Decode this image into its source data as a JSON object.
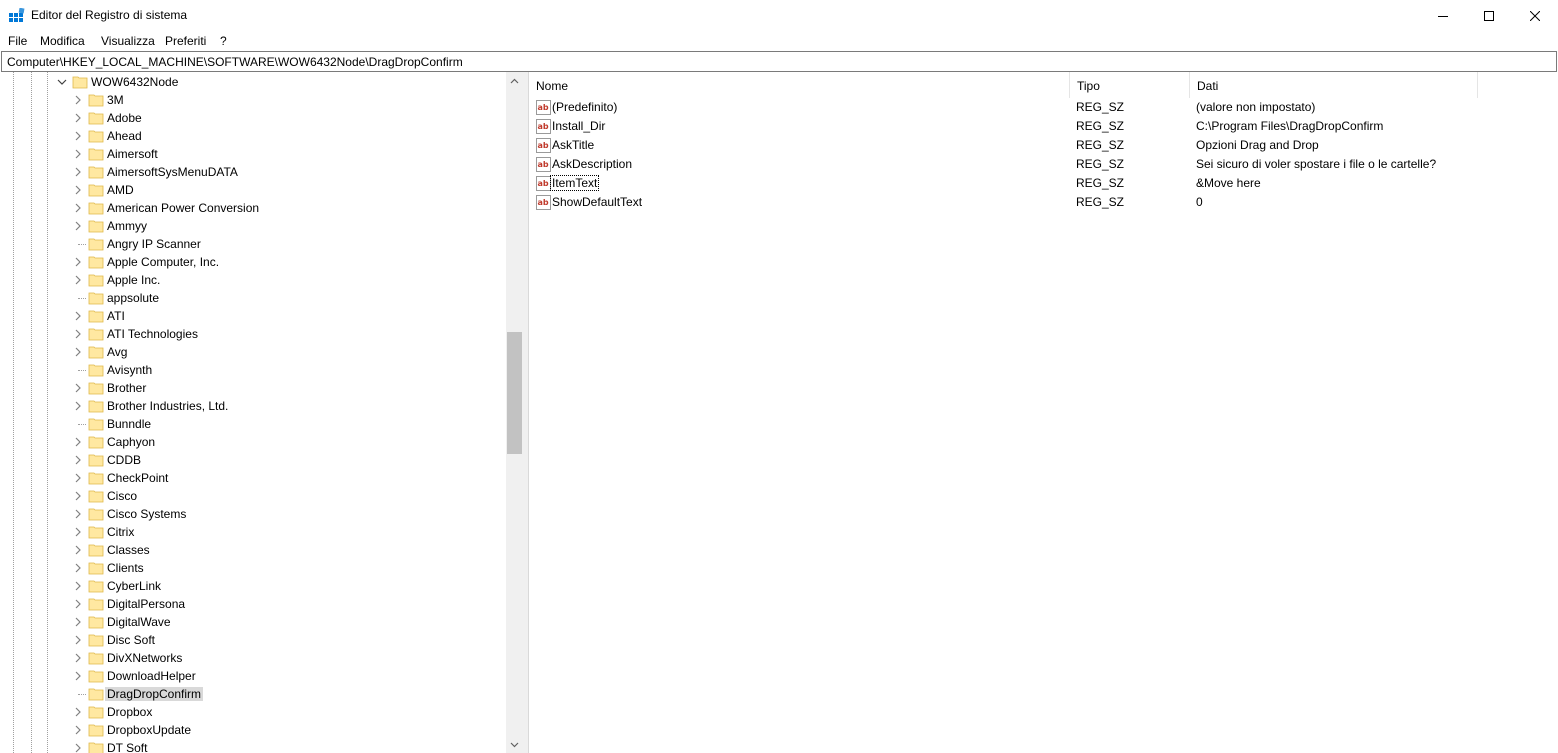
{
  "window": {
    "title": "Editor del Registro di sistema",
    "accent_color": "#0078d7"
  },
  "menu": [
    "File",
    "Modifica",
    "Visualizza",
    "Preferiti",
    "?"
  ],
  "address": "Computer\\HKEY_LOCAL_MACHINE\\SOFTWARE\\WOW6432Node\\DragDropConfirm",
  "tree": {
    "parent": "WOW6432Node",
    "children": [
      {
        "label": "3M",
        "expandable": true
      },
      {
        "label": "Adobe",
        "expandable": true
      },
      {
        "label": "Ahead",
        "expandable": true
      },
      {
        "label": "Aimersoft",
        "expandable": true
      },
      {
        "label": "AimersoftSysMenuDATA",
        "expandable": true
      },
      {
        "label": "AMD",
        "expandable": true
      },
      {
        "label": "American Power Conversion",
        "expandable": true
      },
      {
        "label": "Ammyy",
        "expandable": true
      },
      {
        "label": "Angry IP Scanner",
        "expandable": false
      },
      {
        "label": "Apple Computer, Inc.",
        "expandable": true
      },
      {
        "label": "Apple Inc.",
        "expandable": true
      },
      {
        "label": "appsolute",
        "expandable": false
      },
      {
        "label": "ATI",
        "expandable": true
      },
      {
        "label": "ATI Technologies",
        "expandable": true
      },
      {
        "label": "Avg",
        "expandable": true
      },
      {
        "label": "Avisynth",
        "expandable": false
      },
      {
        "label": "Brother",
        "expandable": true
      },
      {
        "label": "Brother Industries, Ltd.",
        "expandable": true
      },
      {
        "label": "Bunndle",
        "expandable": false
      },
      {
        "label": "Caphyon",
        "expandable": true
      },
      {
        "label": "CDDB",
        "expandable": true
      },
      {
        "label": "CheckPoint",
        "expandable": true
      },
      {
        "label": "Cisco",
        "expandable": true
      },
      {
        "label": "Cisco Systems",
        "expandable": true
      },
      {
        "label": "Citrix",
        "expandable": true
      },
      {
        "label": "Classes",
        "expandable": true
      },
      {
        "label": "Clients",
        "expandable": true
      },
      {
        "label": "CyberLink",
        "expandable": true
      },
      {
        "label": "DigitalPersona",
        "expandable": true
      },
      {
        "label": "DigitalWave",
        "expandable": true
      },
      {
        "label": "Disc Soft",
        "expandable": true
      },
      {
        "label": "DivXNetworks",
        "expandable": true
      },
      {
        "label": "DownloadHelper",
        "expandable": true
      },
      {
        "label": "DragDropConfirm",
        "expandable": false,
        "selected": true
      },
      {
        "label": "Dropbox",
        "expandable": true
      },
      {
        "label": "DropboxUpdate",
        "expandable": true
      },
      {
        "label": "DT Soft",
        "expandable": true
      }
    ]
  },
  "list": {
    "columns": {
      "name": "Nome",
      "type": "Tipo",
      "data": "Dati"
    },
    "rows": [
      {
        "name": "(Predefinito)",
        "type": "REG_SZ",
        "data": "(valore non impostato)"
      },
      {
        "name": "Install_Dir",
        "type": "REG_SZ",
        "data": "C:\\Program Files\\DragDropConfirm"
      },
      {
        "name": "AskTitle",
        "type": "REG_SZ",
        "data": "Opzioni Drag and Drop"
      },
      {
        "name": "AskDescription",
        "type": "REG_SZ",
        "data": "Sei sicuro di voler spostare i file o le cartelle?"
      },
      {
        "name": "ItemText",
        "type": "REG_SZ",
        "data": "&Move here",
        "focused": true
      },
      {
        "name": "ShowDefaultText",
        "type": "REG_SZ",
        "data": "0"
      }
    ]
  }
}
